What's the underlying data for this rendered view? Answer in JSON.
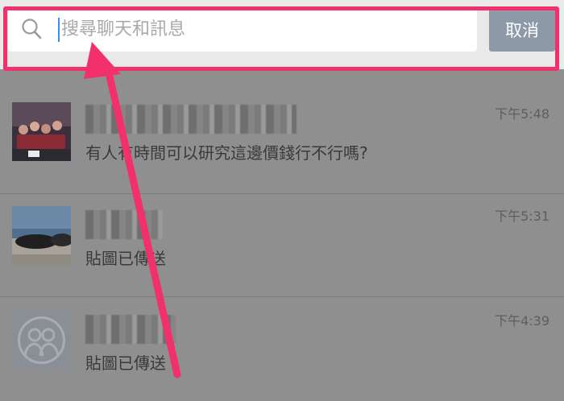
{
  "search": {
    "placeholder": "搜尋聊天和訊息",
    "cancel_label": "取消"
  },
  "chats": [
    {
      "message": "有人有時間可以研究這邊價錢行不行嗎?",
      "time": "下午5:48",
      "avatar": "group-photo"
    },
    {
      "message": "貼圖已傳送",
      "time": "下午5:31",
      "avatar": "sunglasses-photo"
    },
    {
      "message": "貼圖已傳送",
      "time": "下午4:39",
      "avatar": "default-group-icon"
    }
  ],
  "colors": {
    "annotation": "#f2306b",
    "cancel_button": "#8d99a7",
    "cursor": "#3b8ef0"
  }
}
